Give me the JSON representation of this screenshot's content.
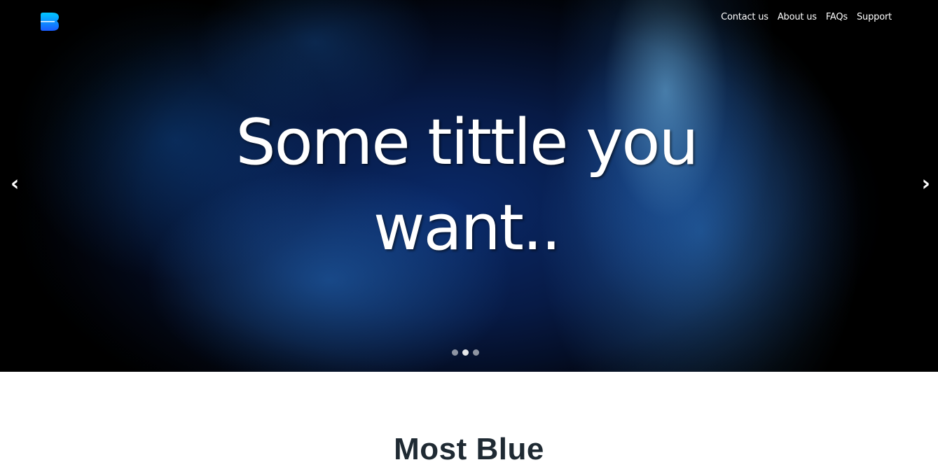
{
  "header": {
    "logo_icon": "brand-b-logo-icon",
    "nav": [
      "Contact us",
      "About us",
      "FAQs",
      "Support"
    ]
  },
  "hero": {
    "title": "Some tittle you want..",
    "prev_icon": "chevron-left-icon",
    "prev_glyph": "‹",
    "next_icon": "chevron-right-icon",
    "next_glyph": "›",
    "slides_count": 3,
    "active_slide": 2
  },
  "section": {
    "heading": "Most Blue"
  },
  "colors": {
    "logo_gradient_start": "#00c6ff",
    "logo_gradient_end": "#1a5cff",
    "heading_text": "#1f2a33"
  }
}
